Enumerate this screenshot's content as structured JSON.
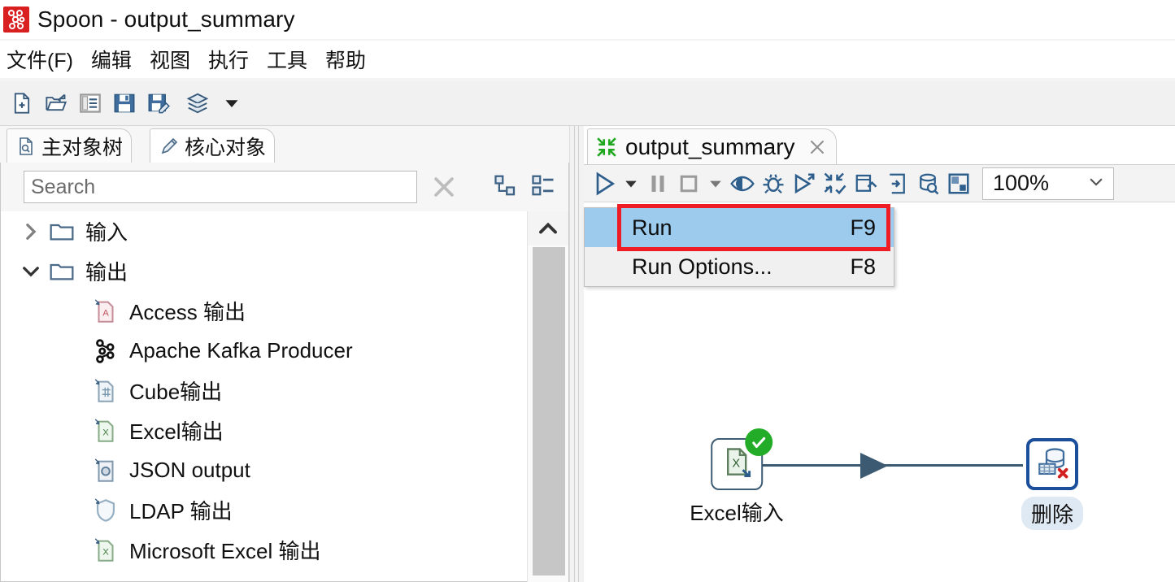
{
  "window": {
    "title": "Spoon - output_summary",
    "logo_icon": "spoon-logo-icon"
  },
  "menubar": {
    "items": [
      {
        "label": "文件(F)",
        "name": "menu-file"
      },
      {
        "label": "编辑",
        "name": "menu-edit"
      },
      {
        "label": "视图",
        "name": "menu-view"
      },
      {
        "label": "执行",
        "name": "menu-run"
      },
      {
        "label": "工具",
        "name": "menu-tools"
      },
      {
        "label": "帮助",
        "name": "menu-help"
      }
    ]
  },
  "main_toolbar": {
    "buttons": [
      {
        "icon": "new-file-icon",
        "name": "new-file-button"
      },
      {
        "icon": "open-file-icon",
        "name": "open-file-button"
      },
      {
        "icon": "explore-repository-icon",
        "name": "explore-repository-button"
      },
      {
        "icon": "save-icon",
        "name": "save-button"
      },
      {
        "icon": "save-as-icon",
        "name": "save-as-button"
      },
      {
        "icon": "layers-icon",
        "name": "layers-button"
      },
      {
        "icon": "chevron-down-icon",
        "name": "toolbar-overflow-button"
      }
    ]
  },
  "left_panel": {
    "tabs": [
      {
        "label": "主对象树",
        "icon": "document-search-icon",
        "selected": false
      },
      {
        "label": "核心对象",
        "icon": "pencil-icon",
        "selected": true
      }
    ],
    "search": {
      "value": "",
      "placeholder": "Search",
      "clear_icon": "close-x-icon",
      "collapse_icon": "collapse-tree-icon",
      "expand_icon": "expand-list-icon"
    },
    "tree": [
      {
        "label": "输入",
        "icon": "folder-icon",
        "twisty": "chevron-right-icon",
        "level": 0
      },
      {
        "label": "输出",
        "icon": "folder-icon",
        "twisty": "chevron-down-icon",
        "level": 0
      },
      {
        "label": "Access 输出",
        "icon": "access-output-icon",
        "level": 1
      },
      {
        "label": "Apache Kafka Producer",
        "icon": "kafka-icon",
        "level": 1
      },
      {
        "label": "Cube输出",
        "icon": "cube-output-icon",
        "level": 1
      },
      {
        "label": "Excel输出",
        "icon": "excel-output-icon",
        "level": 1
      },
      {
        "label": "JSON output",
        "icon": "json-output-icon",
        "level": 1
      },
      {
        "label": "LDAP 输出",
        "icon": "ldap-output-icon",
        "level": 1
      },
      {
        "label": "Microsoft Excel 输出",
        "icon": "excel-output-icon",
        "level": 1
      }
    ],
    "scrollbar": {
      "up_icon": "chevron-up-icon"
    }
  },
  "right_panel": {
    "tab": {
      "title": "output_summary",
      "icon": "transformation-icon",
      "close_icon": "close-x-icon"
    },
    "toolbar": {
      "buttons": [
        {
          "icon": "run-icon",
          "name": "run-button"
        },
        {
          "icon": "chevron-down-icon",
          "name": "run-dropdown-button"
        },
        {
          "icon": "pause-icon",
          "name": "pause-button"
        },
        {
          "icon": "stop-icon",
          "name": "stop-button"
        },
        {
          "icon": "chevron-down-icon",
          "name": "stop-dropdown-button"
        },
        {
          "icon": "preview-eye-icon",
          "name": "preview-button"
        },
        {
          "icon": "debug-bug-icon",
          "name": "debug-button"
        },
        {
          "icon": "replay-icon",
          "name": "replay-button"
        },
        {
          "icon": "verify-transformation-icon",
          "name": "verify-button"
        },
        {
          "icon": "impact-analysis-icon",
          "name": "impact-analysis-button"
        },
        {
          "icon": "sql-editor-icon",
          "name": "sql-button"
        },
        {
          "icon": "database-explore-icon",
          "name": "database-explore-button"
        },
        {
          "icon": "show-grid-icon",
          "name": "arrange-button"
        }
      ],
      "zoom": {
        "value": "100%",
        "chevron_icon": "chevron-down-icon"
      }
    },
    "canvas": {
      "steps": [
        {
          "label": "Excel输入",
          "icon": "excel-input-icon",
          "status_badge": "success-check-icon",
          "selected": false
        },
        {
          "label": "删除",
          "icon": "delete-database-icon",
          "selected": true
        }
      ],
      "hops": [
        {
          "from": "Excel输入",
          "to": "删除",
          "arrow_icon": "hop-arrow-icon"
        }
      ]
    }
  },
  "dropdown_menu": {
    "items": [
      {
        "label": "Run",
        "accel": "F9",
        "highlighted": true
      },
      {
        "label": "Run Options...",
        "accel": "F8",
        "highlighted": false
      }
    ],
    "annotation_color": "#ee1c25",
    "highlight_color": "#9ccbee"
  }
}
